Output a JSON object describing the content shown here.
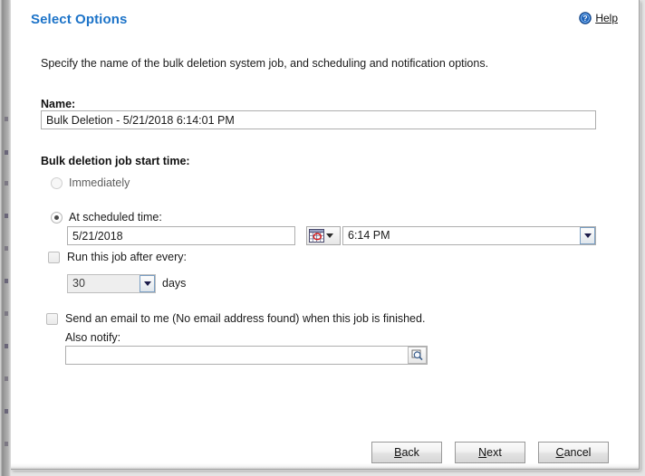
{
  "dialog": {
    "title": "Select Options",
    "help": {
      "label": "Help",
      "accel": "H",
      "rest": "elp",
      "icon": "help-circle-icon"
    },
    "intro": "Specify the name of the bulk deletion system job, and scheduling and notification options."
  },
  "name_section": {
    "label": "Name:",
    "value": "Bulk Deletion - 5/21/2018 6:14:01 PM",
    "placeholder": ""
  },
  "start_time_section": {
    "label": "Bulk deletion job start time:",
    "immediately": {
      "label": "Immediately",
      "selected": false,
      "enabled": false
    },
    "at_scheduled": {
      "label": "At scheduled time:",
      "selected": true
    },
    "date": {
      "value": "5/21/2018",
      "placeholder": ""
    },
    "date_picker_icon": "calendar-icon",
    "time": {
      "value": "6:14 PM"
    }
  },
  "recurrence_section": {
    "checkbox_label": "Run this job after every:",
    "checked": false,
    "interval_value": "30",
    "unit_label": "days",
    "enabled": false
  },
  "notification_section": {
    "checkbox_label": "Send an email to me (No email address found) when this job is finished.",
    "checked": false,
    "also_notify_label": "Also notify:",
    "also_notify_value": "",
    "also_notify_placeholder": "",
    "lookup_icon": "lookup-search-icon"
  },
  "footer": {
    "back": {
      "accel": "B",
      "rest": "ack",
      "label": "Back"
    },
    "next": {
      "accel": "N",
      "rest": "ext",
      "label": "Next"
    },
    "cancel": {
      "accel": "C",
      "rest": "ancel",
      "label": "Cancel"
    }
  },
  "colors": {
    "title_blue": "#1c73c8",
    "dialog_bg": "#ffffff",
    "desktop_gray": "#9a9a9a"
  }
}
